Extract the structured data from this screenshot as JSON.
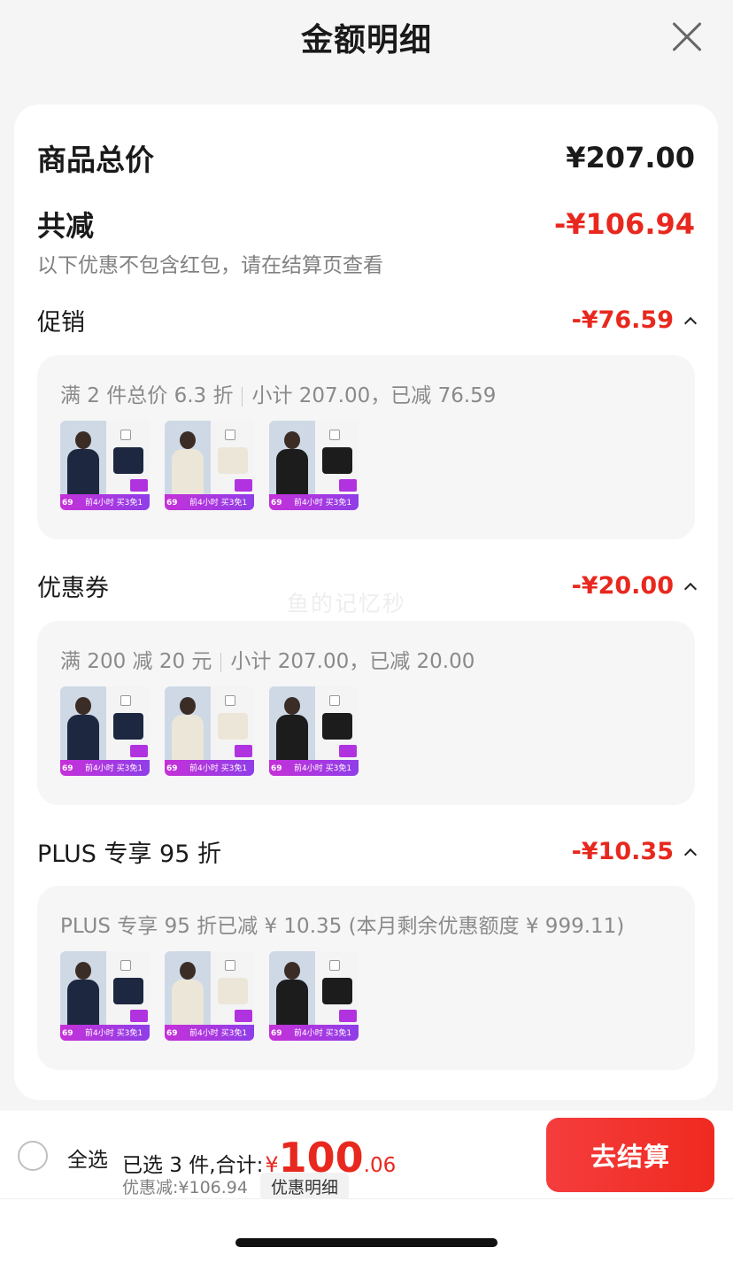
{
  "header": {
    "title": "金额明细",
    "close_icon": "close-icon"
  },
  "summary": {
    "total_label": "商品总价",
    "total_amount": "¥207.00",
    "reduce_label": "共减",
    "reduce_amount": "-¥106.94",
    "note": "以下优惠不包含红包，请在结算页查看"
  },
  "sections": [
    {
      "label": "促销",
      "amount": "-¥76.59",
      "rule": "满 2 件总价 6.3 折",
      "subtotal": "小计 207.00，已减 76.59"
    },
    {
      "label": "优惠券",
      "amount": "-¥20.00",
      "rule": "满 200 减 20 元",
      "subtotal": "小计 207.00，已减 20.00"
    },
    {
      "label": "PLUS 专享 95 折",
      "amount": "-¥10.35",
      "rule": "PLUS 专享 95 折已减 ¥ 10.35 (本月剩余优惠额度 ¥ 999.11)",
      "subtotal": ""
    }
  ],
  "products": [
    {
      "price": "69",
      "bar_text": "前4小时 买3免1",
      "shirt_color": "#1d2740",
      "body_color": "#1d2740"
    },
    {
      "price": "69",
      "bar_text": "前4小时 买3免1",
      "shirt_color": "#ece6d8",
      "body_color": "#ece6d8"
    },
    {
      "price": "69",
      "bar_text": "前4小时 买3免1",
      "shirt_color": "#1c1c1c",
      "body_color": "#1c1c1c"
    }
  ],
  "watermark": "鱼的记忆秒",
  "bottom": {
    "select_all": "全选",
    "selected_text": "已选 3 件,合计:",
    "currency": "¥",
    "amount_int": "100",
    "amount_dec": ".06",
    "discount_text": "优惠减:¥106.94",
    "detail_button": "优惠明细",
    "checkout_button": "去结算"
  },
  "colors": {
    "accent_red": "#e8281e",
    "badge_purple": "#b133e0"
  }
}
